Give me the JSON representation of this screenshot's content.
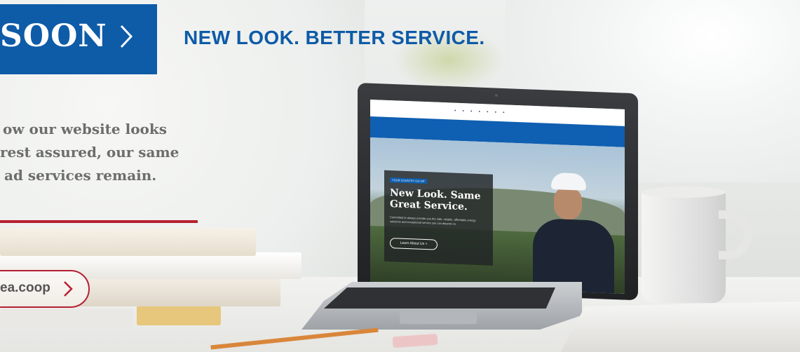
{
  "banner": {
    "coming_soon_fragment": "SOON",
    "headline": "NEW LOOK. BETTER SERVICE."
  },
  "intro": {
    "line1": "ow our website looks",
    "line2": "rest assured, our same",
    "line3": "ad services remain."
  },
  "cta": {
    "url_fragment": "ea.coop"
  },
  "laptop_screen": {
    "eyebrow": "YOUR COUNTRY CO-OP",
    "title": "New Look. Same Great Service.",
    "body": "Committed to always provide you the safe, reliable, affordable energy solutions and exceptional service you can depend on.",
    "button": "Learn About Us  >"
  },
  "colors": {
    "brand_blue": "#0e5ba8",
    "accent_red": "#b62032",
    "intro_gray": "#6d6d6d"
  }
}
